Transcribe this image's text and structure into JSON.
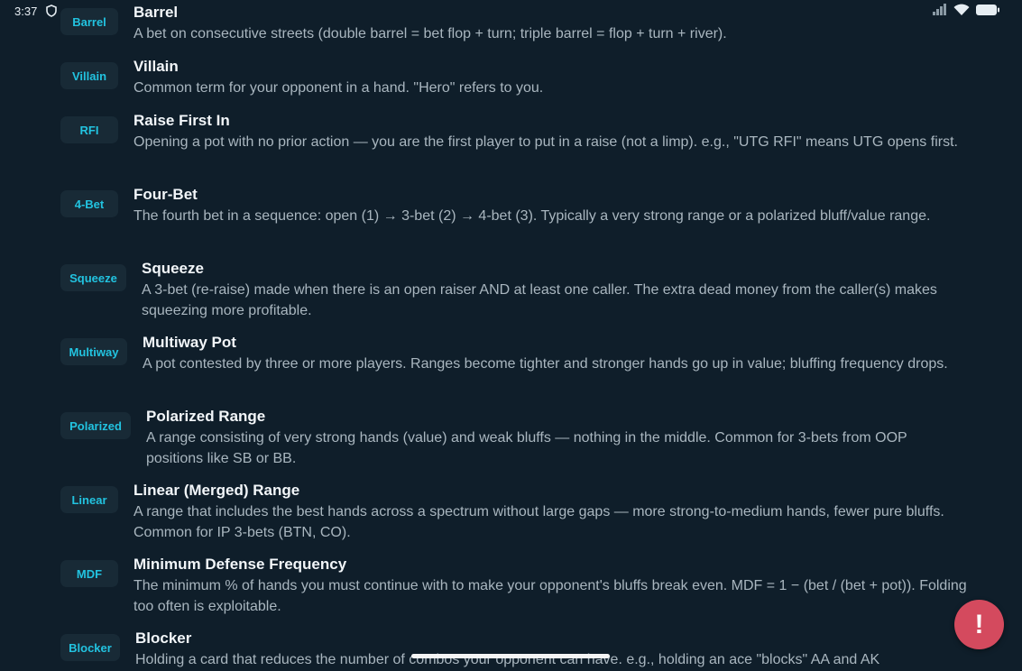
{
  "status": {
    "time": "3:37"
  },
  "entries": [
    {
      "tag": "Barrel",
      "term": "Barrel",
      "def": "A bet on consecutive streets (double barrel = bet flop + turn; triple barrel = flop + turn + river)."
    },
    {
      "tag": "Villain",
      "term": "Villain",
      "def": "Common term for your opponent in a hand. \"Hero\" refers to you."
    },
    {
      "tag": "RFI",
      "term": "Raise First In",
      "def": "Opening a pot with no prior action — you are the first player to put in a raise (not a limp). e.g., \"UTG RFI\" means UTG opens first."
    },
    {
      "tag": "4-Bet",
      "term": "Four-Bet",
      "def": "The fourth bet in a sequence: open (1) → 3-bet (2) → 4-bet (3). Typically a very strong range or a polarized bluff/value range."
    },
    {
      "tag": "Squeeze",
      "term": "Squeeze",
      "def": "A 3-bet (re-raise) made when there is an open raiser AND at least one caller. The extra dead money from the caller(s) makes squeezing more profitable."
    },
    {
      "tag": "Multiway",
      "term": "Multiway Pot",
      "def": "A pot contested by three or more players. Ranges become tighter and stronger hands go up in value; bluffing frequency drops."
    },
    {
      "tag": "Polarized",
      "term": "Polarized Range",
      "def": "A range consisting of very strong hands (value) and weak bluffs — nothing in the middle. Common for 3-bets from OOP positions like SB or BB."
    },
    {
      "tag": "Linear",
      "term": "Linear (Merged) Range",
      "def": "A range that includes the best hands across a spectrum without large gaps — more strong-to-medium hands, fewer pure bluffs. Common for IP 3-bets (BTN, CO)."
    },
    {
      "tag": "MDF",
      "term": "Minimum Defense Frequency",
      "def": "The minimum % of hands you must continue with to make your opponent's bluffs break even. MDF = 1 − (bet / (bet + pot)). Folding too often is exploitable."
    },
    {
      "tag": "Blocker",
      "term": "Blocker",
      "def": "Holding a card that reduces the number of combos your opponent can have. e.g., holding an ace \"blocks\" AA and AK"
    }
  ],
  "fab": {
    "label": "!"
  },
  "colors": {
    "background": "#0f1e2a",
    "accent": "#22c3e0",
    "tag_bg": "#182a36",
    "fab": "#d44a5e"
  }
}
